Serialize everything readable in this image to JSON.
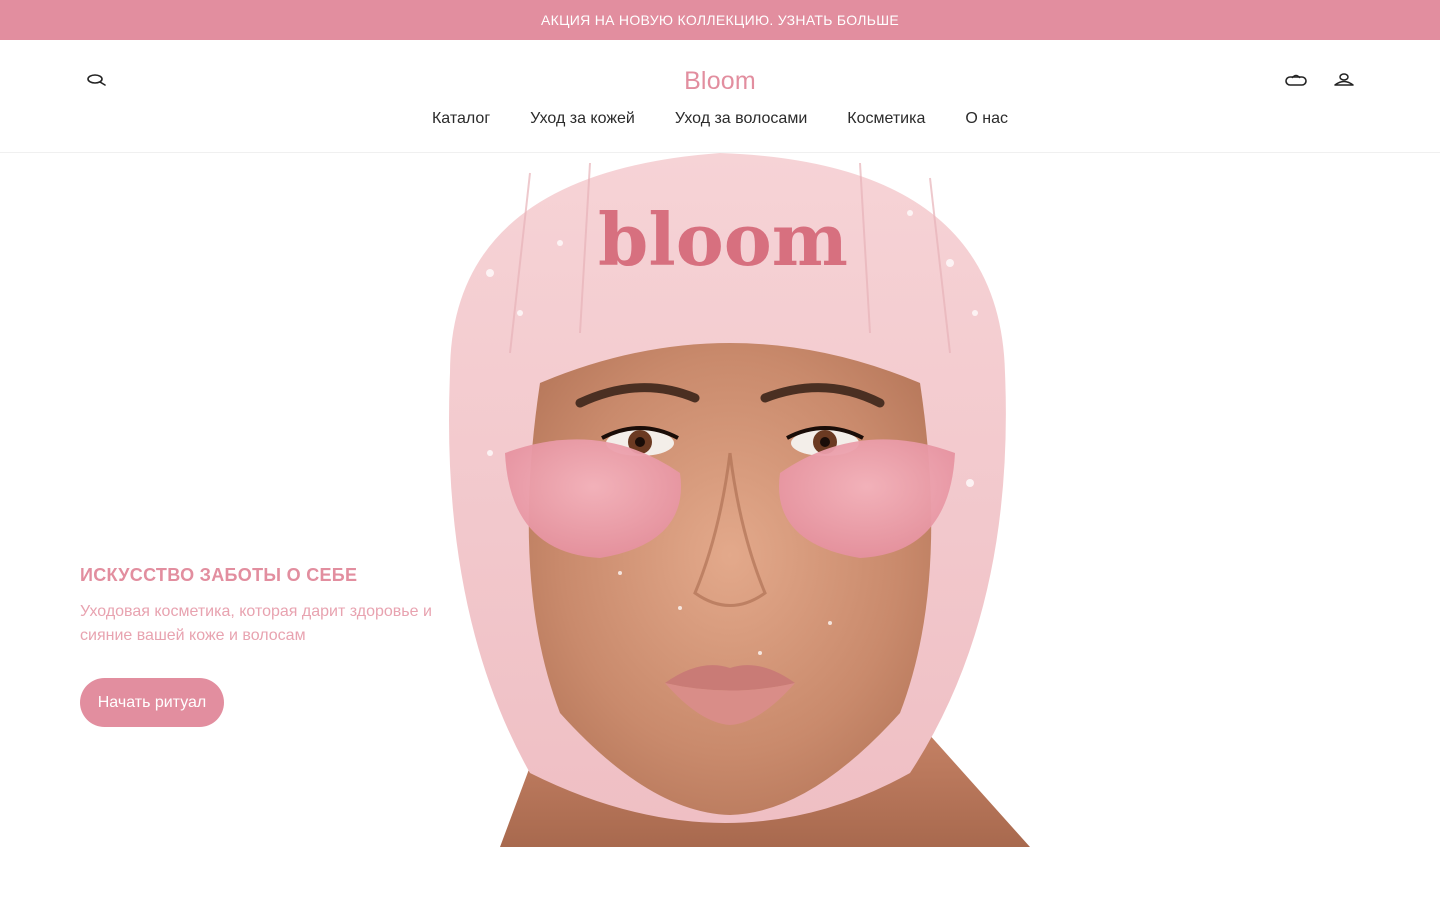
{
  "promo": {
    "text": "АКЦИЯ НА НОВУЮ КОЛЛЕКЦИЮ. УЗНАТЬ БОЛЬШЕ"
  },
  "header": {
    "logo": "Bloom",
    "search_icon": "search-icon",
    "cart_icon": "bag-icon",
    "account_icon": "user-icon",
    "nav": [
      {
        "label": "Каталог"
      },
      {
        "label": "Уход за кожей"
      },
      {
        "label": "Уход за волосами"
      },
      {
        "label": "Косметика"
      },
      {
        "label": "О нас"
      }
    ]
  },
  "hero": {
    "title": "ИСКУССТВО ЗАБОТЫ О СЕБЕ",
    "subtitle": "Уходовая косметика, которая дарит здоровье и сияние вашей коже и волосам",
    "cta_label": "Начать ритуал",
    "hat_text": "bloom"
  },
  "colors": {
    "accent": "#e28e9f",
    "accent_light": "#e8a3b0",
    "text": "#2b2b2b"
  }
}
